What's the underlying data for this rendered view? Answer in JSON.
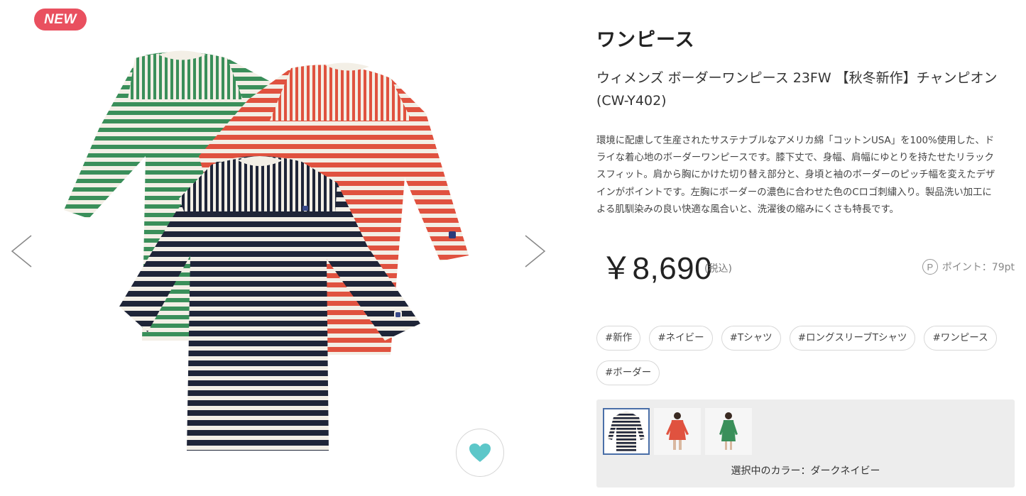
{
  "gallery": {
    "badge": "NEW",
    "prev_icon": "chevron-left-icon",
    "next_icon": "chevron-right-icon",
    "favorite_icon": "heart-icon",
    "colors": {
      "badge": "#e9505f",
      "heart": "#5cc7c9"
    }
  },
  "product": {
    "category": "ワンピース",
    "name": "ウィメンズ ボーダーワンピース 23FW 【秋冬新作】チャンピオン(CW-Y402)",
    "description": "環境に配慮して生産されたサステナブルなアメリカ綿「コットンUSA」を100%使用した、ドライな着心地のボーダーワンピースです。膝下丈で、身幅、肩幅にゆとりを持たせたリラックスフィット。肩から胸にかけた切り替え部分と、身頃と袖のボーダーのピッチ幅を変えたデザインがポイントです。左胸にボーダーの濃色に合わせた色のCロゴ刺繍入り。製品洗い加工による肌馴染みの良い快適な風合いと、洗濯後の縮みにくさも特長です。",
    "price": "￥8,690",
    "tax_note": "(税込)",
    "points_icon": "P",
    "points_label": "ポイント：79pt"
  },
  "tags": [
    "#新作",
    "#ネイビー",
    "#Tシャツ",
    "#ロングスリーブTシャツ",
    "#ワンピース",
    "#ボーダー"
  ],
  "color_selector": {
    "options": [
      {
        "name": "dark-navy",
        "selected": true
      },
      {
        "name": "red",
        "selected": false
      },
      {
        "name": "green",
        "selected": false
      }
    ],
    "selected_label": "選択中のカラー：ダークネイビー",
    "colors": {
      "navy": "#1f2538",
      "red": "#e0523f",
      "green": "#3a8f5a",
      "cream": "#f3efe6",
      "selected_border": "#4a6fa8"
    }
  }
}
